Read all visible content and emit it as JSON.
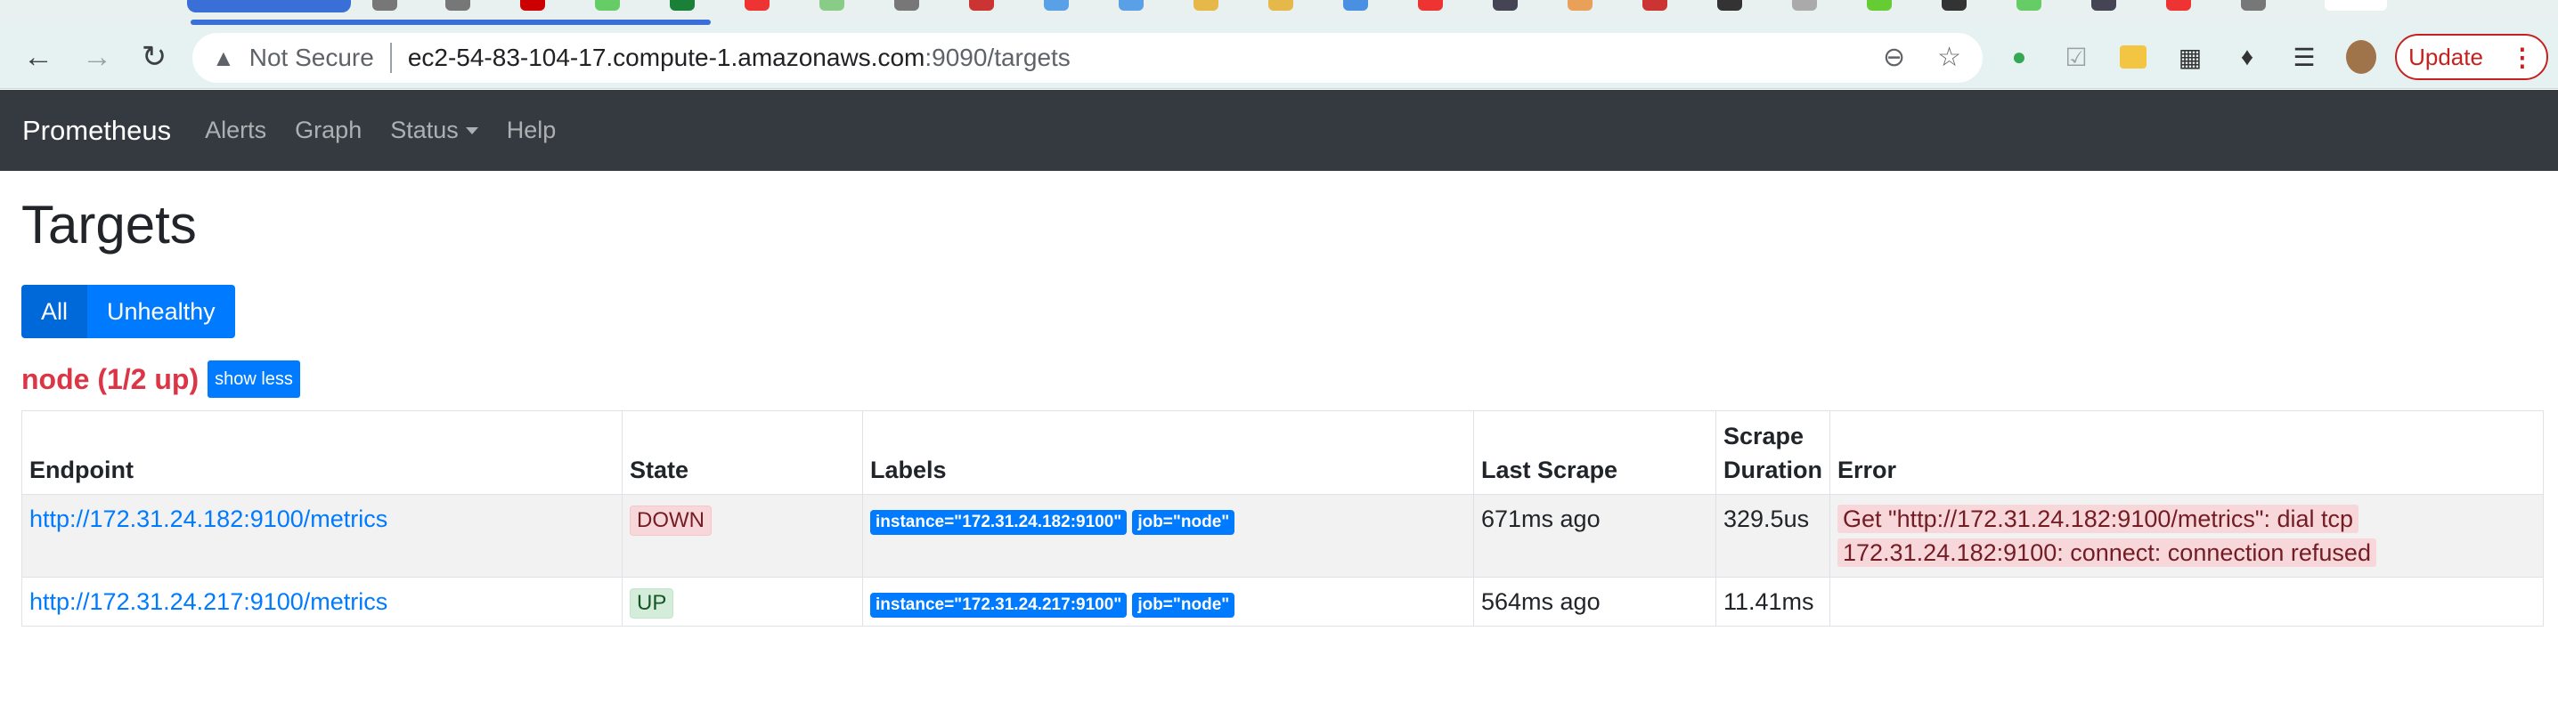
{
  "browser": {
    "address": {
      "security_label": "Not Secure",
      "host": "ec2-54-83-104-17.compute-1.amazonaws.com",
      "port_path": ":9090/targets"
    },
    "update_label": "Update",
    "icons": [
      "back-icon",
      "forward-icon",
      "reload-icon",
      "warning-icon",
      "zoom-icon",
      "star-icon",
      "extension-icons",
      "profile-avatar",
      "more-icon"
    ]
  },
  "navbar": {
    "brand": "Prometheus",
    "links": [
      "Alerts",
      "Graph",
      "Status",
      "Help"
    ]
  },
  "page": {
    "title": "Targets",
    "filter_all": "All",
    "filter_unhealthy": "Unhealthy",
    "job_title": "node (1/2 up)",
    "show_less": "show less"
  },
  "table": {
    "headers": {
      "endpoint": "Endpoint",
      "state": "State",
      "labels": "Labels",
      "last_scrape": "Last Scrape",
      "scrape_duration": "Scrape Duration",
      "error": "Error"
    },
    "rows": [
      {
        "endpoint": "http://172.31.24.182:9100/metrics",
        "state": "DOWN",
        "label_instance": "instance=\"172.31.24.182:9100\"",
        "label_job": "job=\"node\"",
        "last_scrape": "671ms ago",
        "scrape_duration": "329.5us",
        "error": "Get \"http://172.31.24.182:9100/metrics\": dial tcp 172.31.24.182:9100: connect: connection refused"
      },
      {
        "endpoint": "http://172.31.24.217:9100/metrics",
        "state": "UP",
        "label_instance": "instance=\"172.31.24.217:9100\"",
        "label_job": "job=\"node\"",
        "last_scrape": "564ms ago",
        "scrape_duration": "11.41ms",
        "error": ""
      }
    ]
  },
  "colors": {
    "navbar_bg": "#343a40",
    "primary": "#007bff",
    "danger": "#dc3545"
  }
}
